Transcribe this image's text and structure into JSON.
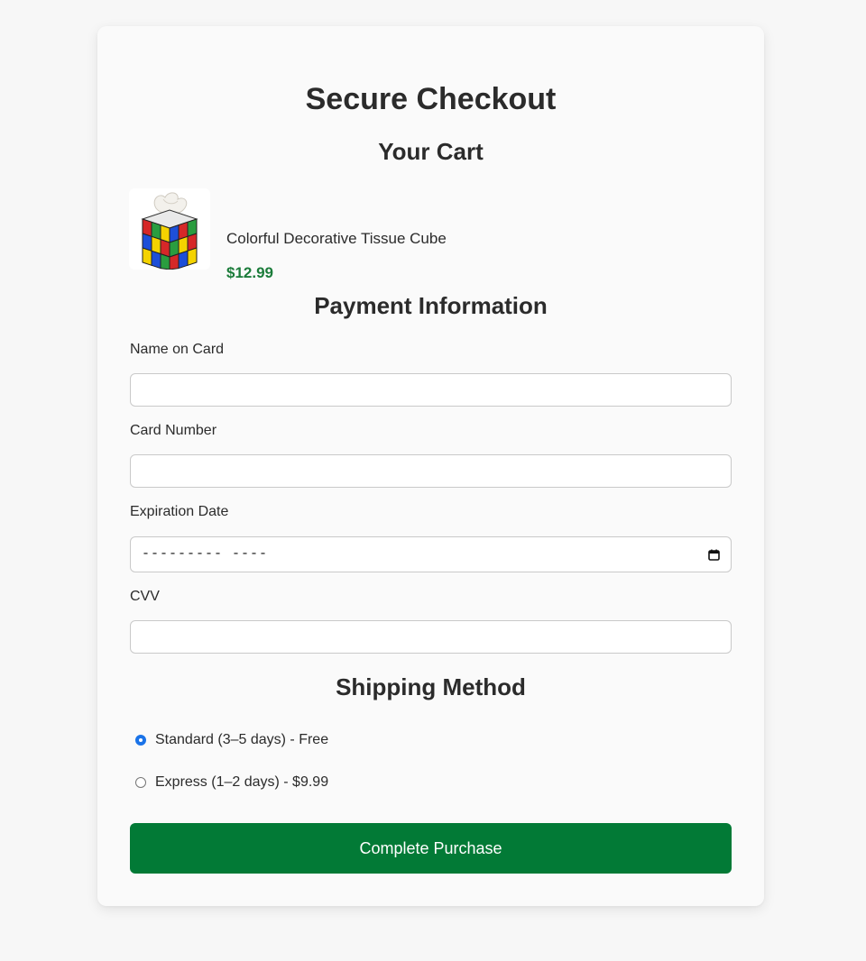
{
  "page": {
    "title": "Secure Checkout"
  },
  "cart": {
    "heading": "Your Cart",
    "item": {
      "name": "Colorful Decorative Tissue Cube",
      "price": "$12.99",
      "image": "rubiks-cube-tissue-box-image"
    }
  },
  "payment": {
    "heading": "Payment Information",
    "name_label": "Name on Card",
    "name_value": "",
    "card_number_label": "Card Number",
    "card_number_value": "",
    "expiration_label": "Expiration Date",
    "expiration_placeholder": "--------- ----",
    "cvv_label": "CVV",
    "cvv_value": ""
  },
  "shipping": {
    "heading": "Shipping Method",
    "options": [
      {
        "label": "Standard (3–5 days) - Free",
        "selected": true
      },
      {
        "label": "Express (1–2 days) - $9.99",
        "selected": false
      }
    ]
  },
  "submit": {
    "label": "Complete Purchase"
  },
  "icons": {
    "calendar": "calendar-icon"
  },
  "colors": {
    "accent_green": "#027a36",
    "price_green": "#1b7c3a",
    "radio_blue": "#1a73e8"
  }
}
